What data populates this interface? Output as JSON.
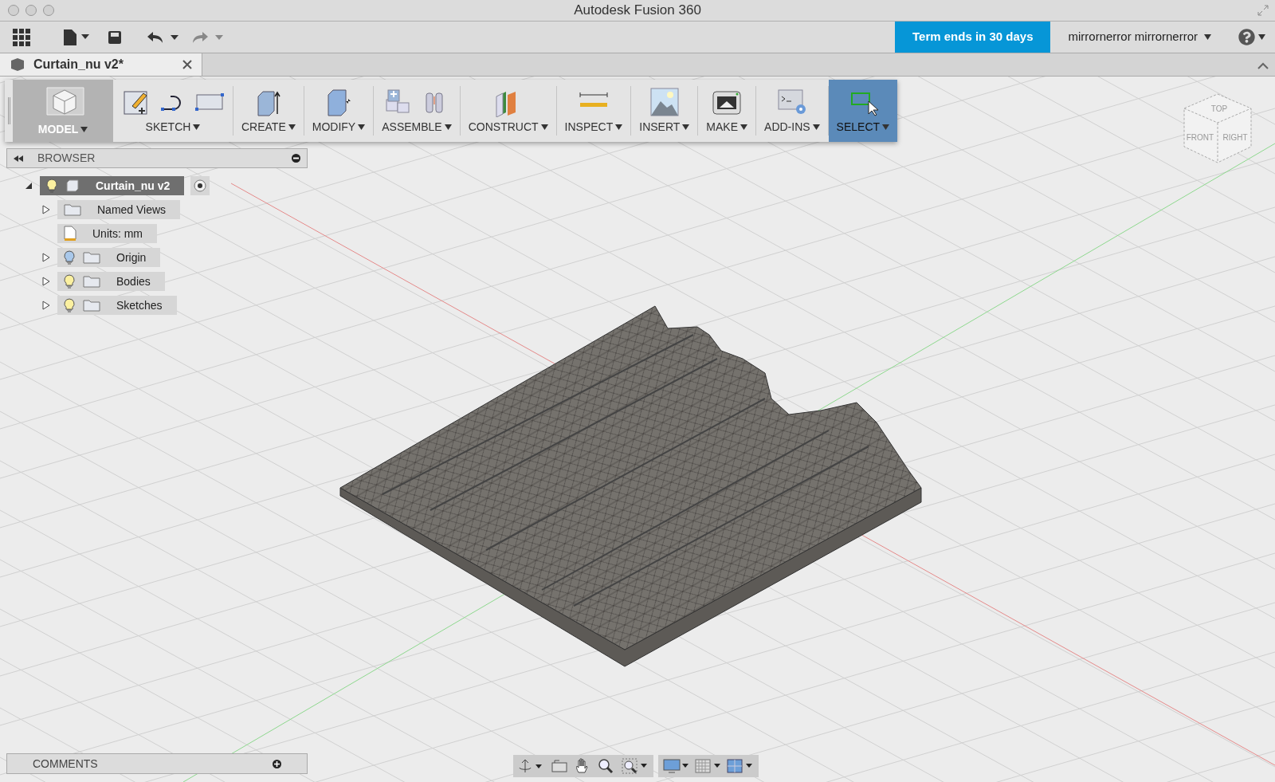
{
  "window": {
    "title": "Autodesk Fusion 360"
  },
  "trial_badge": "Term ends in 30 days",
  "user_menu": "mirrornerror mirrornerror",
  "document_tab": {
    "label": "Curtain_nu v2*",
    "selected": true
  },
  "ribbon": {
    "workspace": {
      "label": "MODEL",
      "selected": true
    },
    "groups": [
      {
        "kind": "sketch",
        "label": "SKETCH",
        "selected": false
      },
      {
        "kind": "create",
        "label": "CREATE",
        "selected": false
      },
      {
        "kind": "modify",
        "label": "MODIFY",
        "selected": false
      },
      {
        "kind": "assemble",
        "label": "ASSEMBLE",
        "selected": false
      },
      {
        "kind": "construct",
        "label": "CONSTRUCT",
        "selected": false
      },
      {
        "kind": "inspect",
        "label": "INSPECT",
        "selected": false
      },
      {
        "kind": "insert",
        "label": "INSERT",
        "selected": false
      },
      {
        "kind": "make",
        "label": "MAKE",
        "selected": false
      },
      {
        "kind": "addins",
        "label": "ADD-INS",
        "selected": false
      },
      {
        "kind": "select",
        "label": "SELECT",
        "selected": true
      }
    ]
  },
  "browser": {
    "title": "BROWSER",
    "tree": [
      {
        "kind": "component",
        "label": "Curtain_nu v2",
        "selected": true,
        "expanded": true,
        "visible": true,
        "children": [
          {
            "kind": "folder",
            "label": "Named Views",
            "selected": false,
            "expanded": false
          },
          {
            "kind": "units",
            "label": "Units: mm",
            "selected": false
          },
          {
            "kind": "group",
            "label": "Origin",
            "selected": false,
            "expanded": false,
            "visible": false
          },
          {
            "kind": "group",
            "label": "Bodies",
            "selected": false,
            "expanded": false,
            "visible": true
          },
          {
            "kind": "group",
            "label": "Sketches",
            "selected": false,
            "expanded": false,
            "visible": true
          }
        ]
      }
    ]
  },
  "view_cube": {
    "top": "TOP",
    "front": "FRONT",
    "right": "RIGHT"
  },
  "comments": {
    "title": "COMMENTS"
  }
}
